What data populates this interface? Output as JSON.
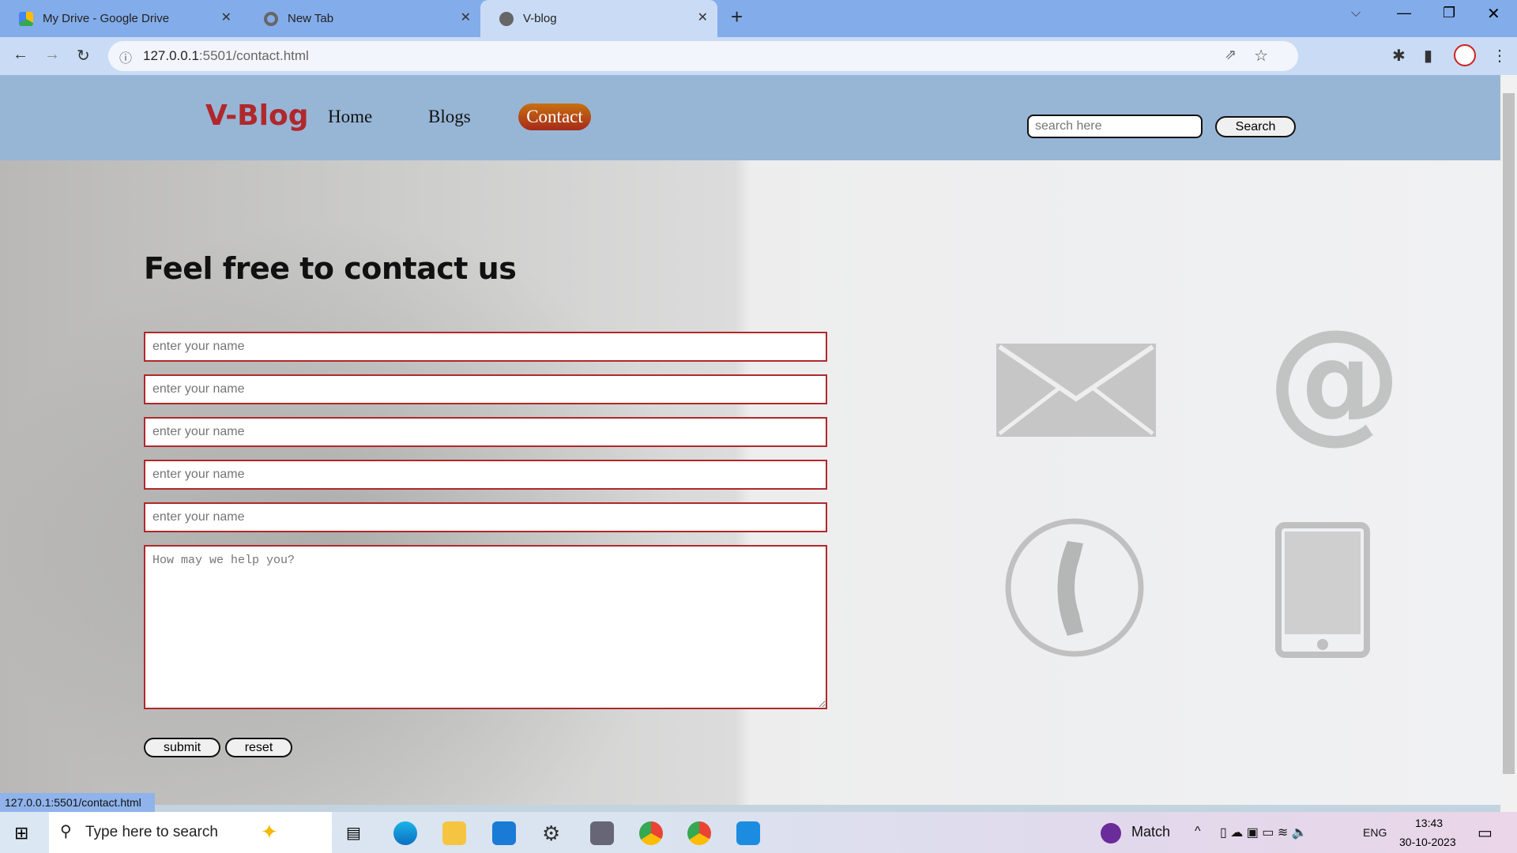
{
  "browser": {
    "tabs": [
      {
        "title": "My Drive - Google Drive"
      },
      {
        "title": "New Tab"
      },
      {
        "title": "V-blog",
        "active": true
      }
    ],
    "url_host": "127.0.0.1",
    "url_rest": ":5501/contact.html",
    "status_url": "127.0.0.1:5501/contact.html"
  },
  "site": {
    "logo": "V-Blog",
    "nav": [
      {
        "label": "Home"
      },
      {
        "label": "Blogs"
      },
      {
        "label": "Contact",
        "active": true
      }
    ],
    "search_placeholder": "search here",
    "search_button": "Search",
    "heading": "Feel free to contact us",
    "fields": [
      {
        "placeholder": "enter your name"
      },
      {
        "placeholder": "enter your name"
      },
      {
        "placeholder": "enter your name"
      },
      {
        "placeholder": "enter your name"
      },
      {
        "placeholder": "enter your name"
      }
    ],
    "message_placeholder": "How may we help you?",
    "submit": "submit",
    "reset": "reset",
    "icons": [
      "envelope-icon",
      "at-sign-icon",
      "phone-icon",
      "tablet-icon"
    ],
    "colors": {
      "navbar": "#97b6d6",
      "logo": "#b0282c",
      "field_border": "#b0282c",
      "contact_button": "#b4451a"
    }
  },
  "taskbar": {
    "search_placeholder": "Type here to search",
    "weather": "Match",
    "lang": "ENG",
    "time": "13:43",
    "date": "30-10-2023"
  }
}
